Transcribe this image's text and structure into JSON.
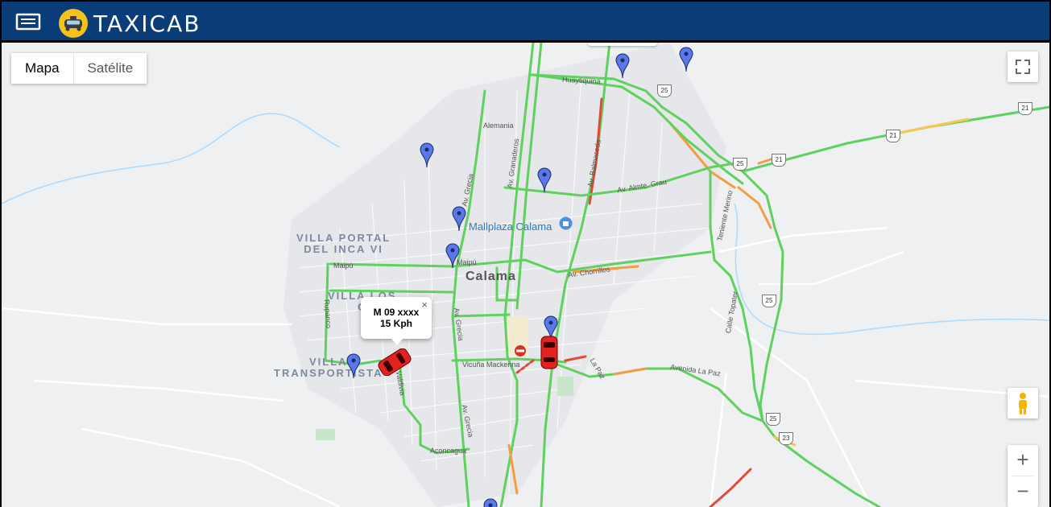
{
  "header": {
    "brand": "TAXICAB",
    "menu_icon": "menu-icon",
    "logo_icon": "taxi-logo-icon",
    "bg_color": "#0a3d78"
  },
  "map": {
    "map_type_buttons": [
      {
        "label": "Mapa",
        "active": true
      },
      {
        "label": "Satélite",
        "active": false
      }
    ],
    "controls": {
      "fullscreen": "fullscreen-icon",
      "street_view": "pegman-icon",
      "zoom_in": "+",
      "zoom_out": "−"
    },
    "areas": {
      "villa_portal": "VILLA PORTAL\nDEL INCA VI",
      "villa_los": "VILLA LOS\nC",
      "villa_transport": "VILLA\nTRANSPORTISTA"
    },
    "city": "Calama",
    "poi": "Mallplaza Calama",
    "streets": {
      "huaytiquina": "Huaytiquina",
      "alemania": "Alemania",
      "granaderos": "Av. Granaderos",
      "balmaceda": "Av. Balmaceda",
      "almte_grau": "Av. Almte. Grau",
      "grecia_top": "Av. Grecia",
      "maipu_left": "Maipú",
      "maipu_center": "Maipú",
      "chorrillos": "Av. Chorrillos",
      "rupanco": "Rupanco",
      "grecia_mid": "Av. Grecia",
      "vicuna": "Vicuña Mackenna",
      "la_paz": "La Paz",
      "avenida_la_paz": "Avenida La Paz",
      "valdivia": "Valdivia",
      "grecia_bottom": "Av. Grecia",
      "aconcagua": "Aconcagua",
      "teniente_merino": "Teniente Merino",
      "calle_topater": "Calle Topater"
    },
    "shields": [
      "25",
      "21",
      "21",
      "21",
      "25",
      "25",
      "25",
      "23"
    ],
    "infowindow": {
      "plate": "M 09 xxxx",
      "speed": "15 Kph",
      "close": "×"
    },
    "colors": {
      "traffic_green": "#5ed15e",
      "traffic_orange": "#f29d42",
      "traffic_red": "#e14a3a",
      "pin_blue": "#5a78e8",
      "car_red": "#e3231f"
    }
  }
}
